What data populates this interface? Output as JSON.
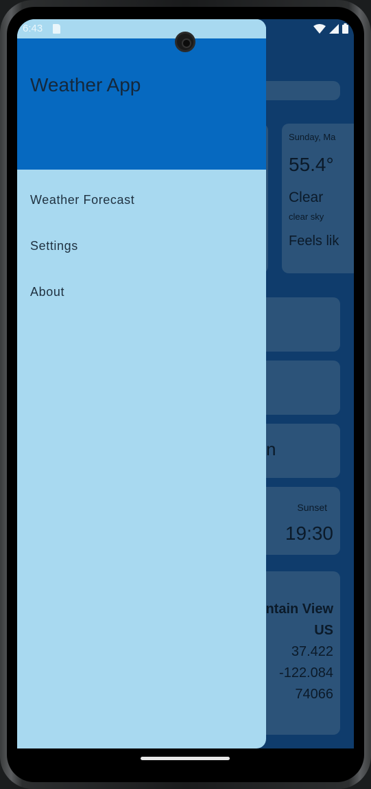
{
  "status_bar": {
    "time": "6:43"
  },
  "drawer": {
    "title": "Weather App",
    "items": [
      {
        "label": "Weather Forecast"
      },
      {
        "label": "Settings"
      },
      {
        "label": "About"
      }
    ]
  },
  "background": {
    "forecast_card": {
      "date": "Sunday, Ma",
      "temperature": "55.4°",
      "condition": "Clear",
      "description": "clear sky",
      "feels_like": "Feels lik"
    },
    "partial_text": "n",
    "sunset": {
      "label": "Sunset",
      "time": "19:30"
    },
    "location": {
      "city": "ntain View",
      "country": "US",
      "latitude": "37.422",
      "longitude": "-122.084",
      "id": "74066"
    }
  },
  "colors": {
    "drawer_background": "#a8d9f0",
    "drawer_header": "#0669c0",
    "app_background": "#0f3c6c"
  }
}
